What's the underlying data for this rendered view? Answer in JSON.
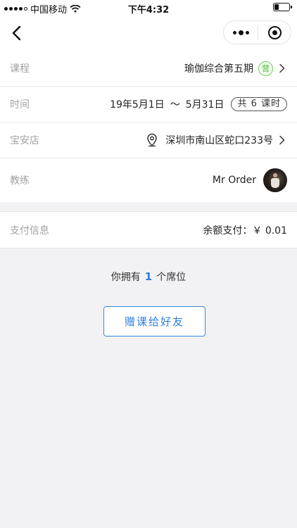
{
  "status_bar": {
    "carrier": "中国移动",
    "time": "下午4:32"
  },
  "course": {
    "label": "课程",
    "value": "瑜伽综合第五期",
    "tag": "营"
  },
  "schedule": {
    "label": "时间",
    "start": "19年5月1日",
    "separator": "～",
    "end": "5月31日",
    "lessons_pill": "共 6 课时"
  },
  "store": {
    "label": "宝安店",
    "address": "深圳市南山区蛇口233号"
  },
  "coach": {
    "label": "教练",
    "name": "Mr Order"
  },
  "payment": {
    "label": "支付信息",
    "value": "余额支付：￥ 0.01"
  },
  "seats": {
    "prefix": "你拥有",
    "count": "1",
    "suffix": "个席位"
  },
  "actions": {
    "gift_label": "赠课给好友"
  },
  "colors": {
    "accent": "#2f7fd9",
    "tag_green": "#4cbb3a",
    "label_gray": "#a2a2a2",
    "background": "#f2f2f4"
  },
  "icons": {
    "back": "chevron-left-icon",
    "more": "more-dots-icon",
    "close": "target-close-icon",
    "location": "location-pin-icon",
    "chevron": "chevron-right-icon"
  }
}
